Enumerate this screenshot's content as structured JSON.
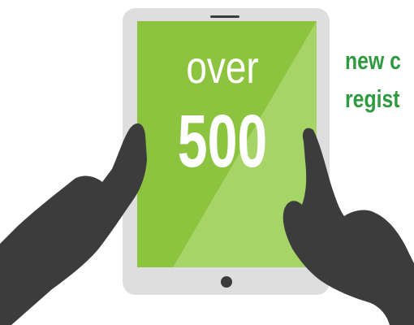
{
  "tablet": {
    "headline_small": "over",
    "headline_number": "500"
  },
  "side_text": {
    "line_1": "new c",
    "line_2": "regist"
  },
  "icons": {
    "tablet": "tablet-icon",
    "home_button": "home-button-icon",
    "left_hand": "left-hand-icon",
    "right_hand": "pointing-hand-icon"
  },
  "colors": {
    "bezel": "#dedede",
    "screen": "#8cc43f",
    "screen_highlight": "#a6d466",
    "hand": "#3c3c3c",
    "side_text": "#2f9a3f",
    "speaker": "#3c3c3c"
  }
}
